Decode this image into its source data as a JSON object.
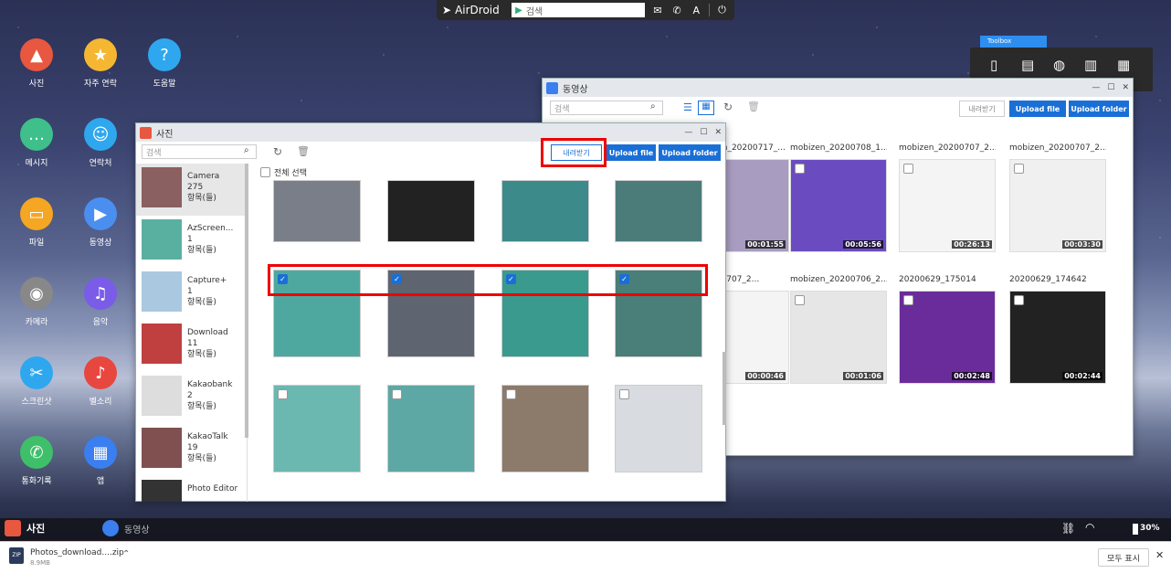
{
  "topbar": {
    "brand": "AirDroid",
    "search_placeholder": "검색"
  },
  "desktop_icons": [
    {
      "label": "사진",
      "icon": "photo-icon",
      "color": "#e8573f"
    },
    {
      "label": "자주 연락",
      "icon": "contact-star-icon",
      "color": "#f5b731"
    },
    {
      "label": "도움말",
      "icon": "help-icon",
      "color": "#2fa7ee"
    },
    {
      "label": "메시지",
      "icon": "message-icon",
      "color": "#3fbf8a"
    },
    {
      "label": "연락처",
      "icon": "contacts-icon",
      "color": "#2fa7ee"
    },
    {
      "label": "파일",
      "icon": "folder-icon",
      "color": "#f5a623"
    },
    {
      "label": "동영상",
      "icon": "video-icon",
      "color": "#4a8ef0"
    },
    {
      "label": "카메라",
      "icon": "camera-icon",
      "color": "#888"
    },
    {
      "label": "음악",
      "icon": "music-icon",
      "color": "#7a5ce8"
    },
    {
      "label": "스크린샷",
      "icon": "scissors-icon",
      "color": "#2fa7ee"
    },
    {
      "label": "벨소리",
      "icon": "bell-icon",
      "color": "#e8473f"
    },
    {
      "label": "통화기록",
      "icon": "phone-icon",
      "color": "#3fbf6a"
    },
    {
      "label": "앱",
      "icon": "apps-icon",
      "color": "#3a7ef0"
    }
  ],
  "toolbox": {
    "label": "Toolbox"
  },
  "video_window": {
    "title": "동영상",
    "search_placeholder": "검색",
    "download_label": "내려받기",
    "upload_file": "Upload file",
    "upload_folder": "Upload folder",
    "videos": [
      {
        "title": "mobizen_20200717_...",
        "duration": "00:01:55",
        "color": "#a89cc0"
      },
      {
        "title": "mobizen_20200708_1...",
        "duration": "00:05:56",
        "color": "#6b4cc0"
      },
      {
        "title": "mobizen_20200707_2...",
        "duration": "00:26:13",
        "color": "#f4f4f4"
      },
      {
        "title": "mobizen_20200707_2...",
        "duration": "00:03:30",
        "color": "#f0f0f0"
      },
      {
        "title": "...20200707_2...",
        "duration": "00:00:46",
        "color": "#f4f4f4"
      },
      {
        "title": "mobizen_20200706_2...",
        "duration": "00:01:06",
        "color": "#e6e6e6"
      },
      {
        "title": "20200629_175014",
        "duration": "00:02:48",
        "color": "#6a2c9a"
      },
      {
        "title": "20200629_174642",
        "duration": "00:02:44",
        "color": "#222"
      }
    ]
  },
  "photo_window": {
    "title": "사진",
    "search_placeholder": "검색",
    "download_label": "내려받기",
    "upload_file": "Upload file",
    "upload_folder": "Upload folder",
    "select_all": "전체 선택",
    "albums": [
      {
        "name": "Camera",
        "count": "275",
        "unit": "항목(들)",
        "color": "#8a6060"
      },
      {
        "name": "AzScreen...",
        "count": "1",
        "unit": "항목(들)",
        "color": "#5ab0a0"
      },
      {
        "name": "Capture+",
        "count": "1",
        "unit": "항목(들)",
        "color": "#aac8e0"
      },
      {
        "name": "Download",
        "count": "11",
        "unit": "항목(들)",
        "color": "#c04040"
      },
      {
        "name": "Kakaobank",
        "count": "2",
        "unit": "항목(들)",
        "color": "#ddd"
      },
      {
        "name": "KakaoTalk",
        "count": "19",
        "unit": "항목(들)",
        "color": "#805050"
      },
      {
        "name": "Photo Editor",
        "count": "",
        "unit": "",
        "color": "#333"
      }
    ],
    "photos": [
      {
        "checked": false,
        "color": "#7a7e88"
      },
      {
        "checked": false,
        "color": "#222"
      },
      {
        "checked": false,
        "color": "#3d8a8a"
      },
      {
        "checked": false,
        "color": "#4b7c7a"
      },
      {
        "checked": true,
        "color": "#4fa8a0"
      },
      {
        "checked": true,
        "color": "#5e6470"
      },
      {
        "checked": true,
        "color": "#3a9a8e"
      },
      {
        "checked": true,
        "color": "#4a7e78"
      },
      {
        "checked": false,
        "color": "#6ab8b0"
      },
      {
        "checked": false,
        "color": "#5da8a4"
      },
      {
        "checked": false,
        "color": "#8c7a6a"
      },
      {
        "checked": false,
        "color": "#d8dce0"
      }
    ]
  },
  "taskbar": {
    "tabs": [
      {
        "label": "사진",
        "icon": "photo-icon"
      },
      {
        "label": "동영상",
        "icon": "video-icon"
      }
    ],
    "battery": "30%"
  },
  "download_bar": {
    "file_name": "Photos_download....zip",
    "file_size": "8.9MB",
    "show_all": "모두 표시"
  }
}
